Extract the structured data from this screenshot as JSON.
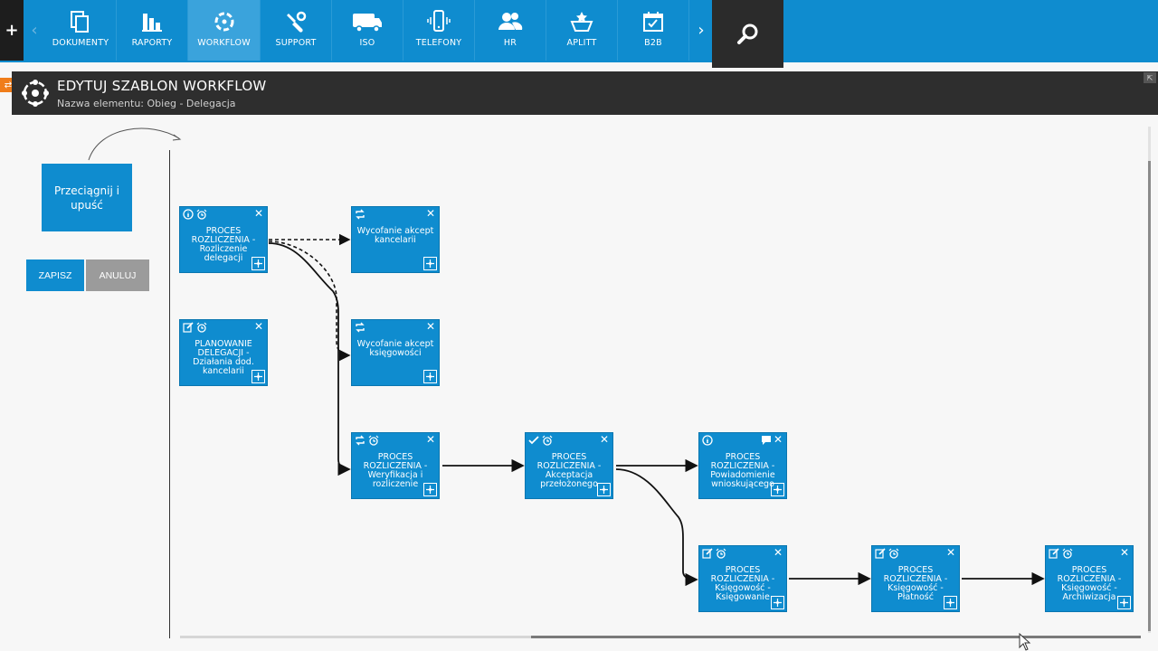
{
  "nav": {
    "plus": "+",
    "prev": "‹",
    "next": "›",
    "items": [
      {
        "label": "DOKUMENTY",
        "icon": "documents-icon"
      },
      {
        "label": "RAPORTY",
        "icon": "reports-icon"
      },
      {
        "label": "WORKFLOW",
        "icon": "workflow-icon",
        "active": true
      },
      {
        "label": "SUPPORT",
        "icon": "support-icon"
      },
      {
        "label": "ISO",
        "icon": "truck-icon"
      },
      {
        "label": "TELEFONY",
        "icon": "phone-icon"
      },
      {
        "label": "HR",
        "icon": "people-icon"
      },
      {
        "label": "APLITT",
        "icon": "basket-icon"
      },
      {
        "label": "B2B",
        "icon": "calendar-check-icon"
      }
    ]
  },
  "header": {
    "title": "EDYTUJ SZABLON WORKFLOW",
    "subtitle": "Nazwa elementu: Obieg - Delegacja"
  },
  "panel": {
    "drag_label": "Przeciągnij i upuść",
    "save_label": "ZAPISZ",
    "cancel_label": "ANULUJ"
  },
  "nodes": [
    {
      "id": "n1",
      "title": "PROCES ROZLICZENIA - Rozliczenie delegacji",
      "icons": [
        "info-icon",
        "alarm-icon"
      ]
    },
    {
      "id": "n2",
      "title": "Wycofanie akcept kancelarii",
      "icons": [
        "loop-icon"
      ]
    },
    {
      "id": "n3",
      "title": "PLANOWANIE DELEGACJI - Działania dod. kancelarii",
      "icons": [
        "edit-icon",
        "alarm-icon"
      ]
    },
    {
      "id": "n4",
      "title": "Wycofanie akcept księgowości",
      "icons": [
        "loop-icon"
      ]
    },
    {
      "id": "n5",
      "title": "PROCES ROZLICZENIA - Weryfikacja i rozliczenie",
      "icons": [
        "loop-icon",
        "alarm-icon"
      ]
    },
    {
      "id": "n6",
      "title": "PROCES ROZLICZENIA - Akceptacja przełożonego",
      "icons": [
        "check-icon",
        "alarm-icon"
      ]
    },
    {
      "id": "n7",
      "title": "PROCES ROZLICZENIA - Powiadomienie wnioskującego",
      "icons": [
        "info-icon"
      ]
    },
    {
      "id": "n8",
      "title": "PROCES ROZLICZENIA - Księgowość - Księgowanie",
      "icons": [
        "edit-icon",
        "alarm-icon"
      ]
    },
    {
      "id": "n9",
      "title": "PROCES ROZLICZENIA - Księgowość - Płatność",
      "icons": [
        "edit-icon",
        "alarm-icon"
      ]
    },
    {
      "id": "n10",
      "title": "PROCES ROZLICZENIA - Księgowość - Archiwizacja",
      "icons": [
        "edit-icon",
        "alarm-icon"
      ]
    }
  ],
  "colors": {
    "accent": "#0f8ccf",
    "header_bg": "#2e2e2e",
    "cancel_bg": "#9b9b9b",
    "search_bg": "#2b2b2b",
    "side_tab": "#f07d1a"
  },
  "close_glyph": "✕"
}
